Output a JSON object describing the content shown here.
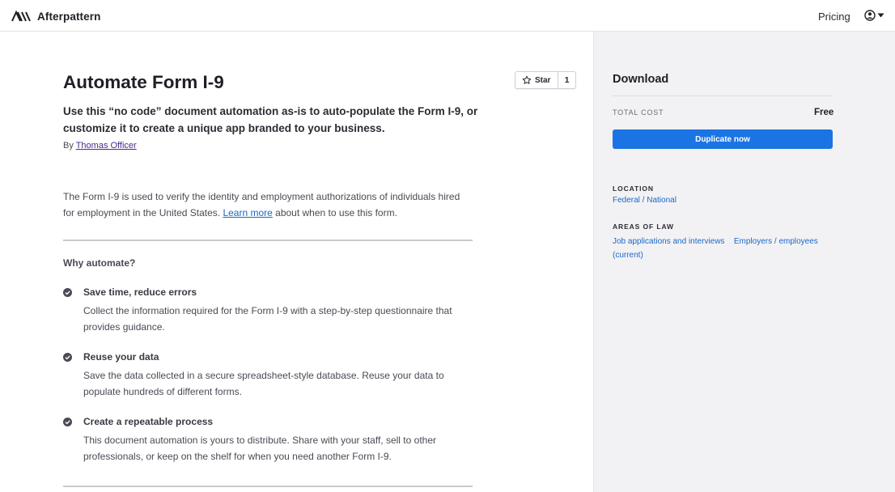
{
  "header": {
    "brand_name": "Afterpattern",
    "pricing_label": "Pricing"
  },
  "main": {
    "title": "Automate Form I-9",
    "subtitle": "Use this “no code” document automation as-is to auto-populate the Form I-9, or customize it to create a unique app branded to your business.",
    "byline_prefix": "By",
    "author": "Thomas Officer",
    "star": {
      "label": "Star",
      "count": "1"
    },
    "intro_before": "The Form I-9 is used to verify the identity and employment authorizations of individuals hired for employment in the United States. ",
    "intro_link": "Learn more",
    "intro_after": " about when to use this form.",
    "why_heading": "Why automate?",
    "features": [
      {
        "title": "Save time, reduce errors",
        "description": "Collect the information required for the Form I-9 with a step-by-step questionnaire that provides guidance."
      },
      {
        "title": "Reuse your data",
        "description": "Save the data collected in a secure spreadsheet-style database. Reuse your data to populate hundreds of different forms."
      },
      {
        "title": "Create a repeatable process",
        "description": "This document automation is yours to distribute. Share with your staff, sell to other professionals, or keep on the shelf for when you need another Form I-9."
      }
    ]
  },
  "sidebar": {
    "title": "Download",
    "cost_label": "TOTAL COST",
    "cost_value": "Free",
    "button_label": "Duplicate now",
    "location_label": "LOCATION",
    "location_value": "Federal / National",
    "areas_label": "AREAS OF LAW",
    "areas": [
      "Job applications and interviews",
      "Employers / employees (current)"
    ]
  },
  "colors": {
    "accent": "#1b74e4",
    "link": "#1b68c8",
    "sidebar_bg": "#f2f2f4"
  },
  "icons": [
    "afterpattern-logo-icon",
    "user-circle-icon",
    "caret-down-icon",
    "star-icon",
    "check-circle-icon"
  ]
}
